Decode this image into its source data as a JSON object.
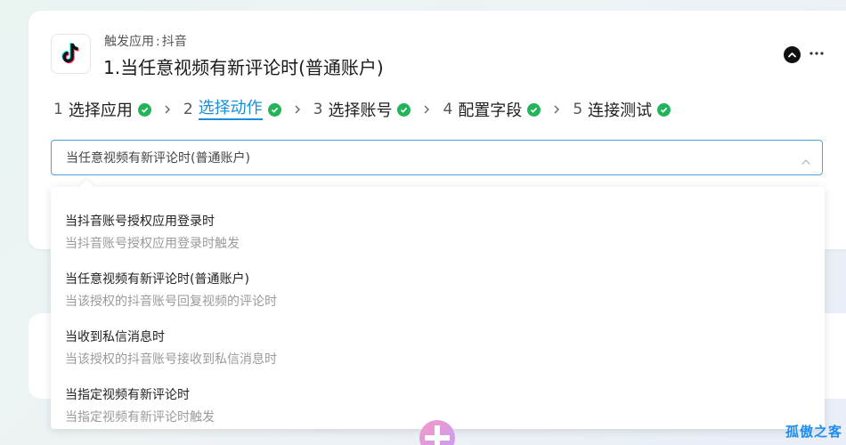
{
  "header": {
    "trigger_prefix": "触发应用",
    "trigger_colon": ":",
    "trigger_app": "抖音",
    "title": "1.当任意视频有新评论时(普通账户)",
    "app_icon": "tiktok-icon"
  },
  "steps": [
    {
      "num": "1",
      "label": "选择应用",
      "done": true
    },
    {
      "num": "2",
      "label": "选择动作",
      "done": true,
      "active": true
    },
    {
      "num": "3",
      "label": "选择账号",
      "done": true
    },
    {
      "num": "4",
      "label": "配置字段",
      "done": true
    },
    {
      "num": "5",
      "label": "连接测试",
      "done": true
    }
  ],
  "select": {
    "value": "当任意视频有新评论时(普通账户)"
  },
  "options": [
    {
      "title": "当抖音账号授权应用登录时",
      "desc": "当抖音账号授权应用登录时触发"
    },
    {
      "title": "当任意视频有新评论时(普通账户)",
      "desc": "当该授权的抖音账号回复视频的评论时"
    },
    {
      "title": "当收到私信消息时",
      "desc": "当该授权的抖音账号接收到私信消息时"
    },
    {
      "title": "当指定视频有新评论时",
      "desc": "当指定视频有新评论时触发"
    }
  ],
  "watermark": "孤傲之客",
  "colors": {
    "accent": "#1a8fd8",
    "success": "#23b45a",
    "watermark": "#1f8ef0"
  }
}
